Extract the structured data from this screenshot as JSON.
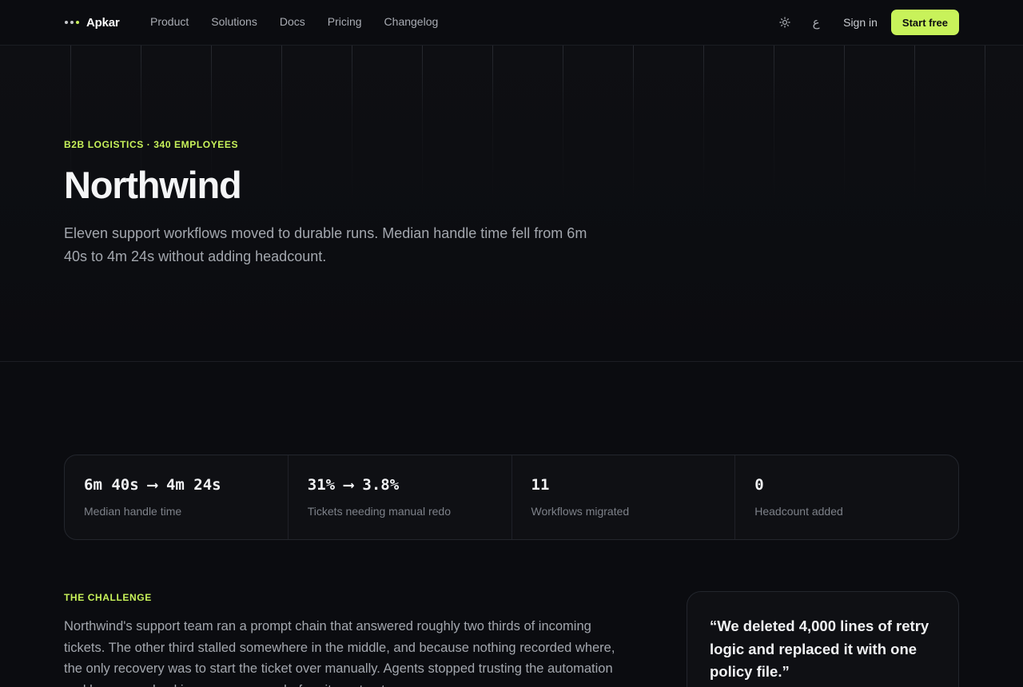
{
  "brand": {
    "name": "Apkar"
  },
  "nav": {
    "links": [
      "Product",
      "Solutions",
      "Docs",
      "Pricing",
      "Changelog"
    ],
    "theme_icon": "sun-icon",
    "language_label": "ع",
    "sign_in": "Sign in",
    "cta": "Start free"
  },
  "hero": {
    "eyebrow": "B2B LOGISTICS · 340 EMPLOYEES",
    "title": "Northwind",
    "subtitle": "Eleven support workflows moved to durable runs. Median handle time fell from 6m 40s to 4m 24s without adding headcount."
  },
  "stats": [
    {
      "value": "6m 40s ⟶ 4m 24s",
      "label": "Median handle time"
    },
    {
      "value": "31% ⟶ 3.8%",
      "label": "Tickets needing manual redo"
    },
    {
      "value": "11",
      "label": "Workflows migrated"
    },
    {
      "value": "0",
      "label": "Headcount added"
    }
  ],
  "challenge": {
    "eyebrow": "THE CHALLENGE",
    "body": "Northwind's support team ran a prompt chain that answered roughly two thirds of incoming tickets. The other third stalled somewhere in the middle, and because nothing recorded where, the only recovery was to start the ticket over manually. Agents stopped trusting the automation and began re-checking every answer before it went out."
  },
  "quote": {
    "text": "“We deleted 4,000 lines of retry logic and replaced it with one policy file.”"
  },
  "colors": {
    "background": "#0b0c10",
    "accent": "#c8f25a",
    "text": "#e8e9ec",
    "muted": "#a3a7ae"
  }
}
